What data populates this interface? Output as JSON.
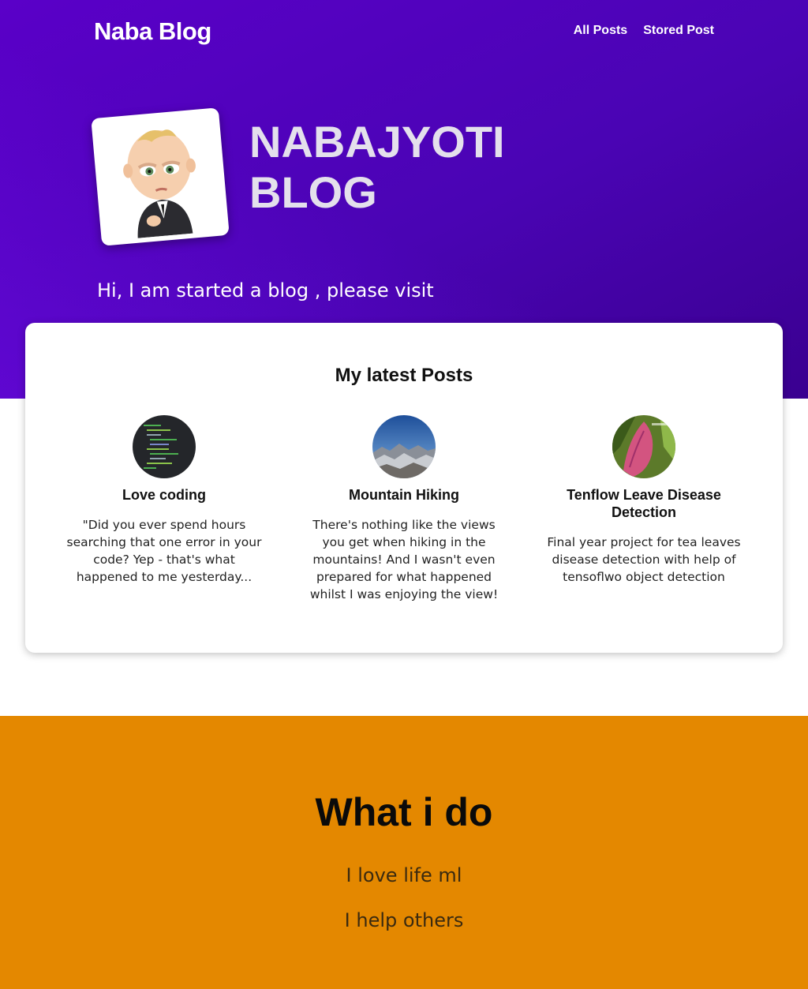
{
  "header": {
    "brand": "Naba Blog",
    "nav": [
      {
        "label": "All Posts"
      },
      {
        "label": "Stored Post"
      }
    ]
  },
  "hero": {
    "title": "NABAJYOTI BLOG",
    "subtitle": "Hi, I am started a blog , please visit",
    "avatar_icon": "boss-baby-avatar"
  },
  "latest": {
    "title": "My latest Posts",
    "posts": [
      {
        "image_icon": "code-screen-image",
        "title": "Love coding",
        "excerpt": "\"Did you ever spend hours searching that one error in your code? Yep - that's what happened to me yesterday..."
      },
      {
        "image_icon": "mountain-image",
        "title": "Mountain Hiking",
        "excerpt": "There's nothing like the views you get when hiking in the mountains! And I wasn't even prepared for what happened whilst I was enjoying the view!"
      },
      {
        "image_icon": "leaf-detection-image",
        "title": "Tenflow Leave Disease Detection",
        "excerpt": "Final year project for tea leaves disease detection with help of tensoflwo object detection"
      }
    ]
  },
  "what_i_do": {
    "title": "What i do",
    "items": [
      "I love life ml",
      "I help others"
    ]
  },
  "colors": {
    "hero": "#4a04b4",
    "accent_section": "#e48800"
  }
}
